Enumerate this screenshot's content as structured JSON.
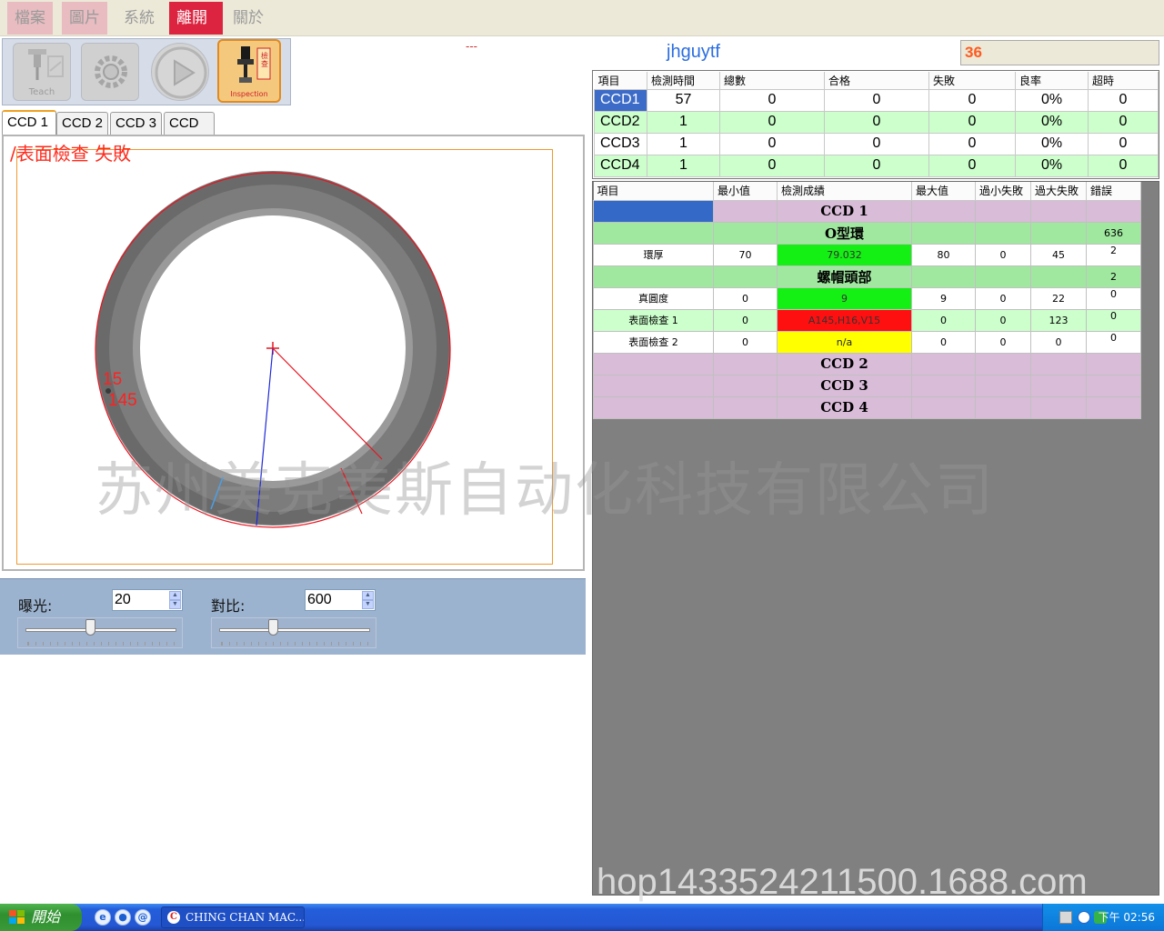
{
  "menu": [
    "檔案",
    "圖片",
    "系統",
    "離開",
    "關於"
  ],
  "toolbar": {
    "teach_label": "Teach",
    "inspection_label": "Inspection",
    "inspection_badge": "檢查"
  },
  "header": {
    "dash": "---",
    "title": "jhguytf",
    "counter": "36"
  },
  "tabs": [
    "CCD 1",
    "CCD 2",
    "CCD 3",
    "CCD 4"
  ],
  "viewer": {
    "status": "/表面檢查 失敗",
    "defect_a": "15",
    "defect_b": "145"
  },
  "controls": {
    "exposure_label": "曝光:",
    "exposure_value": "20",
    "exposure_level": 0.43,
    "contrast_label": "對比:",
    "contrast_value": "600",
    "contrast_level": 0.36
  },
  "summary": {
    "headers": [
      "項目",
      "檢測時間",
      "總數",
      "合格",
      "失敗",
      "良率",
      "超時"
    ],
    "rows": [
      [
        "CCD1",
        "57",
        "0",
        "0",
        "0",
        "0%",
        "0"
      ],
      [
        "CCD2",
        "1",
        "0",
        "0",
        "0",
        "0%",
        "0"
      ],
      [
        "CCD3",
        "1",
        "0",
        "0",
        "0",
        "0%",
        "0"
      ],
      [
        "CCD4",
        "1",
        "0",
        "0",
        "0",
        "0%",
        "0"
      ]
    ]
  },
  "detail": {
    "headers": [
      "項目",
      "最小值",
      "檢測成績",
      "最大值",
      "過小失敗",
      "過大失敗",
      "錯誤"
    ],
    "ccd1": "CCD 1",
    "group1": {
      "name": "O型環",
      "err": "636"
    },
    "row_thickness": [
      "環厚",
      "70",
      "79.032",
      "80",
      "0",
      "45",
      "2"
    ],
    "group2": {
      "name": "螺帽頭部",
      "err": "2"
    },
    "row_roundness": [
      "真圓度",
      "0",
      "9",
      "9",
      "0",
      "22",
      "0"
    ],
    "row_surface1": [
      "表面檢查 1",
      "0",
      "A145,H16,V15",
      "0",
      "0",
      "123",
      "0"
    ],
    "row_surface2": [
      "表面檢查 2",
      "0",
      "n/a",
      "0",
      "0",
      "0",
      "0"
    ],
    "ccd2": "CCD 2",
    "ccd3": "CCD 3",
    "ccd4": "CCD 4"
  },
  "watermark": {
    "company": "苏州美克美斯自动化科技有限公司",
    "url": "hop1433524211500.1688.com"
  },
  "taskbar": {
    "start": "開始",
    "task": "CHING CHAN MAC...",
    "clock": "下午 02:56"
  }
}
